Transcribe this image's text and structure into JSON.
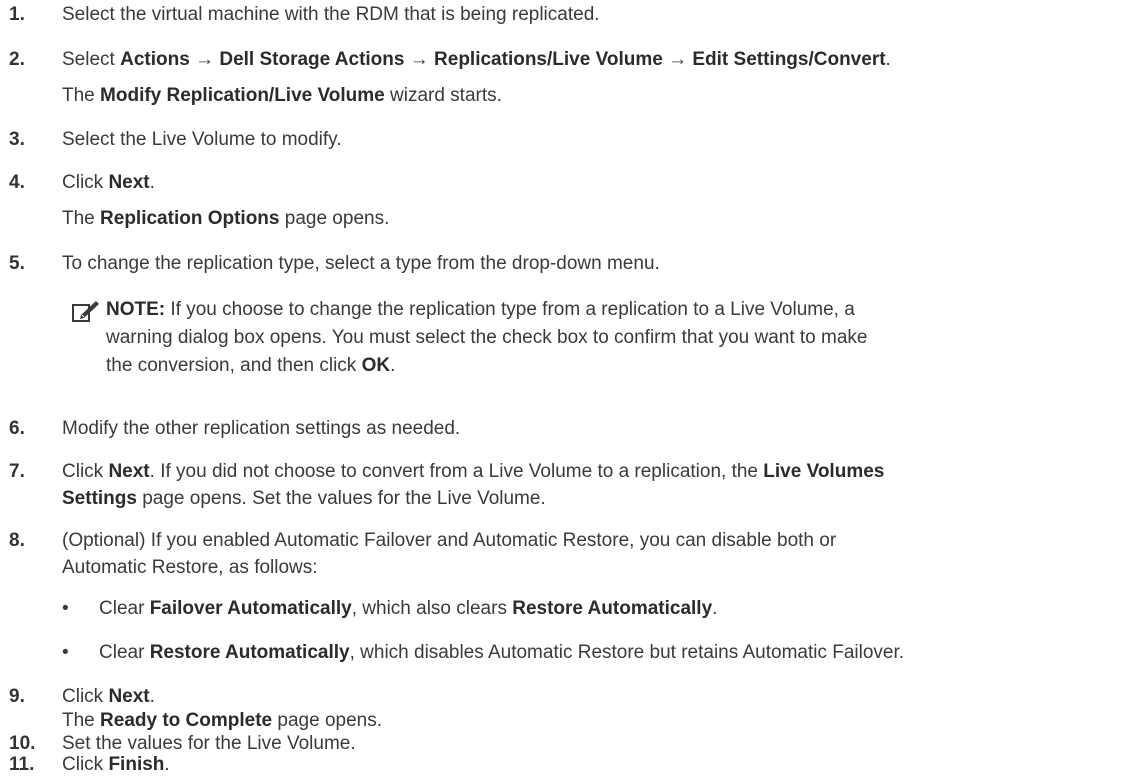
{
  "steps": [
    {
      "num": "1.",
      "text": "Select the virtual machine with the RDM that is being replicated."
    },
    {
      "num": "2.",
      "parts": [
        "Select ",
        "Actions",
        " → ",
        "Dell Storage Actions",
        " → ",
        "Replications/Live Volume",
        " → ",
        "Edit Settings/Convert",
        "."
      ],
      "sub": [
        "The ",
        "Modify Replication/Live Volume",
        " wizard starts."
      ]
    },
    {
      "num": "3.",
      "text": "Select the Live Volume to modify."
    },
    {
      "num": "4.",
      "parts": [
        "Click ",
        "Next",
        "."
      ],
      "sub": [
        "The ",
        "Replication Options",
        " page opens."
      ]
    },
    {
      "num": "5.",
      "text": "To change the replication type, select a type from the drop-down menu."
    },
    {
      "num": "6.",
      "text": "Modify the other replication settings as needed."
    },
    {
      "num": "7.",
      "parts": [
        "Click ",
        "Next",
        ". If you did not choose to convert from a Live Volume to a replication, the ",
        "Live Volumes",
        ""
      ],
      "line2": [
        "Settings",
        " page opens. Set the values for the Live Volume."
      ]
    },
    {
      "num": "8.",
      "line1": "(Optional) If you enabled Automatic Failover and Automatic Restore, you can disable both or",
      "line2": "Automatic Restore, as follows:"
    },
    {
      "num": "9.",
      "parts": [
        "Click ",
        "Next",
        "."
      ],
      "sub": [
        "The ",
        "Ready to Complete",
        " page opens."
      ]
    },
    {
      "num": "10.",
      "text": "Set the values for the Live Volume."
    },
    {
      "num": "11.",
      "parts": [
        "Click ",
        "Finish",
        "."
      ]
    }
  ],
  "note": {
    "label": "NOTE:",
    "line1": " If you choose to change the replication type from a replication to a Live Volume, a",
    "line2": "warning dialog box opens. You must select the check box to confirm that you want to make",
    "line3a": "the conversion, and then click ",
    "line3b": "OK",
    "line3c": "."
  },
  "bullets": [
    {
      "dot": "•",
      "parts": [
        "Clear ",
        "Failover Automatically",
        ", which also clears ",
        "Restore Automatically",
        "."
      ]
    },
    {
      "dot": "•",
      "parts": [
        "Clear ",
        "Restore Automatically",
        ", which disables Automatic Restore but retains Automatic Failover."
      ]
    }
  ]
}
